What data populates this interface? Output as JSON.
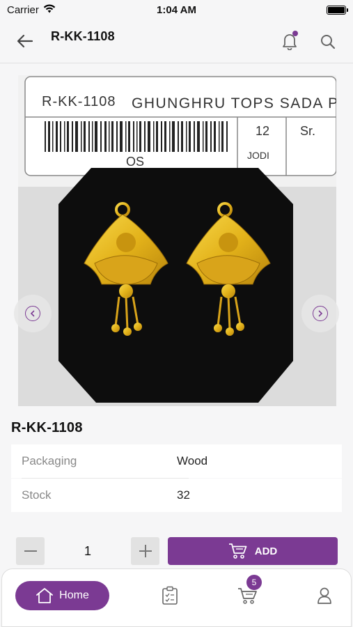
{
  "status_bar": {
    "carrier": "Carrier",
    "time": "1:04 AM"
  },
  "header": {
    "title": "R-KK-1108"
  },
  "product_image": {
    "tag_code": "R-KK-1108",
    "tag_name": "GHUNGHRU TOPS SADA PU",
    "tag_count": "12",
    "tag_unit": "JODI",
    "tag_sr": "Sr.",
    "tag_os": "OS"
  },
  "product": {
    "code": "R-KK-1108",
    "details": [
      {
        "label": "Packaging",
        "value": "Wood"
      },
      {
        "label": "Stock",
        "value": "32"
      }
    ]
  },
  "quantity": {
    "value": "1"
  },
  "add_button": {
    "label": "ADD"
  },
  "bottom_nav": {
    "home_label": "Home",
    "cart_badge": "5"
  },
  "colors": {
    "accent": "#7b3a93",
    "gold": "#e3b21a"
  },
  "icons": [
    "wifi-icon",
    "battery-icon",
    "back-arrow-icon",
    "bell-icon",
    "search-icon",
    "chevron-left-icon",
    "chevron-right-icon",
    "minus-icon",
    "plus-icon",
    "cart-icon",
    "home-icon",
    "clipboard-icon",
    "user-icon"
  ]
}
